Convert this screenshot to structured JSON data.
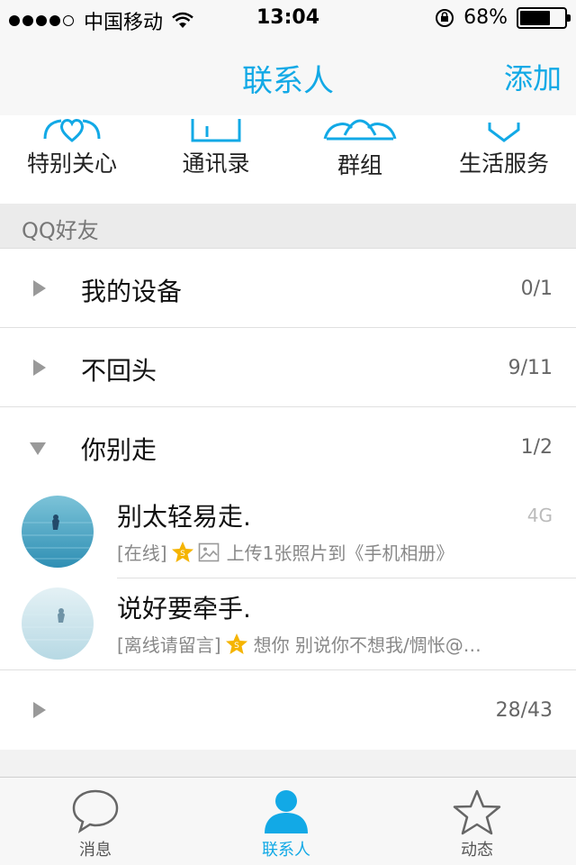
{
  "status": {
    "carrier": "中国移动",
    "time": "13:04",
    "battery": "68%",
    "battery_level": 0.68
  },
  "nav": {
    "title": "联系人",
    "add_label": "添加"
  },
  "quick": [
    {
      "label": "特别关心",
      "icon": "heart-person-icon"
    },
    {
      "label": "通讯录",
      "icon": "contacts-book-icon"
    },
    {
      "label": "群组",
      "icon": "group-icon"
    },
    {
      "label": "生活服务",
      "icon": "service-icon"
    }
  ],
  "section_title": "QQ好友",
  "groups": [
    {
      "name": "我的设备",
      "count": "0/1",
      "expanded": false
    },
    {
      "name": "不回头",
      "count": "9/11",
      "expanded": false
    },
    {
      "name": "你别走",
      "count": "1/2",
      "expanded": true
    }
  ],
  "friends": [
    {
      "name": "别太轻易走.",
      "network": "4G",
      "state": "[在线]",
      "status": "上传1张照片到《手机相册》"
    },
    {
      "name": "说好要牵手.",
      "network": "",
      "state": "[离线请留言]",
      "status": "想你 别说你不想我/惆怅@…"
    }
  ],
  "last_group": {
    "name": "",
    "count": "28/43"
  },
  "tabs": [
    {
      "label": "消息",
      "icon": "message-icon",
      "active": false
    },
    {
      "label": "联系人",
      "icon": "contacts-icon",
      "active": true
    },
    {
      "label": "动态",
      "icon": "star-icon",
      "active": false
    }
  ],
  "colors": {
    "accent": "#12a9e6",
    "star": "#f5b400"
  }
}
